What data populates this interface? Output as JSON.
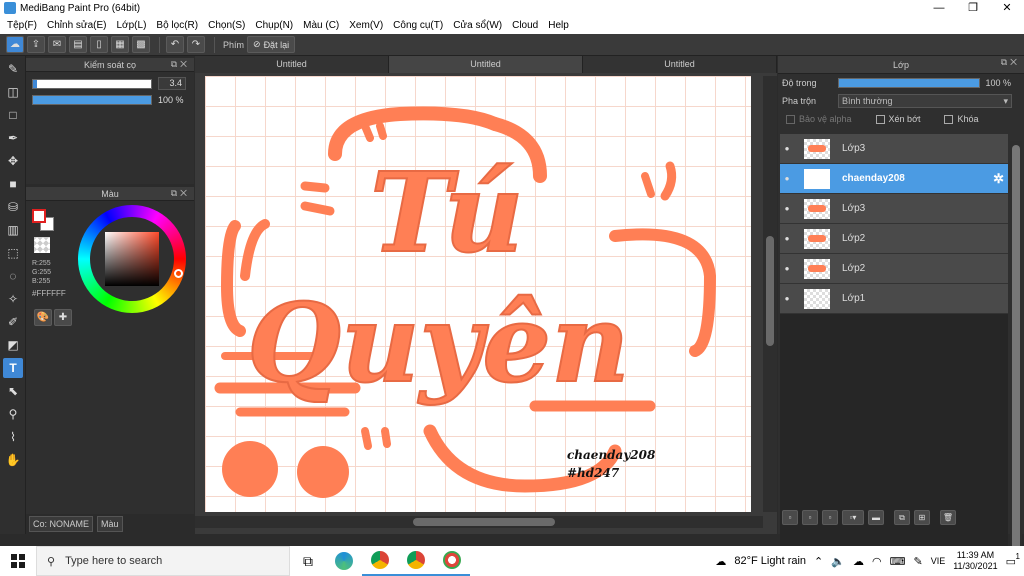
{
  "window": {
    "title": "MediBang Paint Pro (64bit)",
    "controls": [
      "—",
      "❐",
      "✕"
    ]
  },
  "menu": [
    "Tệp(F)",
    "Chỉnh sửa(E)",
    "Lớp(L)",
    "Bộ lọc(R)",
    "Chọn(S)",
    "Chụp(N)",
    "Màu (C)",
    "Xem(V)",
    "Công cụ(T)",
    "Cửa sổ(W)",
    "Cloud",
    "Help"
  ],
  "toolbar": {
    "shortcut_label": "Phím",
    "reset_label": "Đặt lại"
  },
  "brush_panel": {
    "title": "Kiểm soát cọ",
    "size_value": "3.4",
    "opacity_value": "100 %"
  },
  "color_panel": {
    "title": "Màu",
    "r": "R:255",
    "g": "G:255",
    "b": "B:255",
    "hex": "#FFFFFF"
  },
  "canvas_tabs": [
    "Untitled",
    "Untitled",
    "Untitled"
  ],
  "artwork": {
    "line1": "Tú",
    "line2": "Quyên",
    "signature": "chaenday208",
    "hashtag": "#hd247"
  },
  "layer_panel": {
    "title": "Lớp",
    "opacity_label": "Độ trong",
    "opacity_value": "100 %",
    "blend_label": "Pha trộn",
    "blend_value": "Bình thường",
    "protect_alpha": "Bảo vệ alpha",
    "clipping": "Xén bớt",
    "lock": "Khóa",
    "layers": [
      {
        "name": "Lớp3",
        "selected": false
      },
      {
        "name": "chaenday208",
        "selected": true
      },
      {
        "name": "Lớp3",
        "selected": false
      },
      {
        "name": "Lớp2",
        "selected": false
      },
      {
        "name": "Lớp2",
        "selected": false
      },
      {
        "name": "Lớp1",
        "selected": false
      }
    ]
  },
  "status": {
    "color_name": "Co: NONAME",
    "color_tab": "Màu"
  },
  "taskbar": {
    "search_placeholder": "Type here to search",
    "weather": "82°F  Light rain",
    "lang": "VIE",
    "time": "11:39 AM",
    "date": "11/30/2021",
    "notif_count": "1"
  },
  "colors": {
    "accent": "#4b9be3",
    "artwork_orange": "#ff7f55"
  }
}
